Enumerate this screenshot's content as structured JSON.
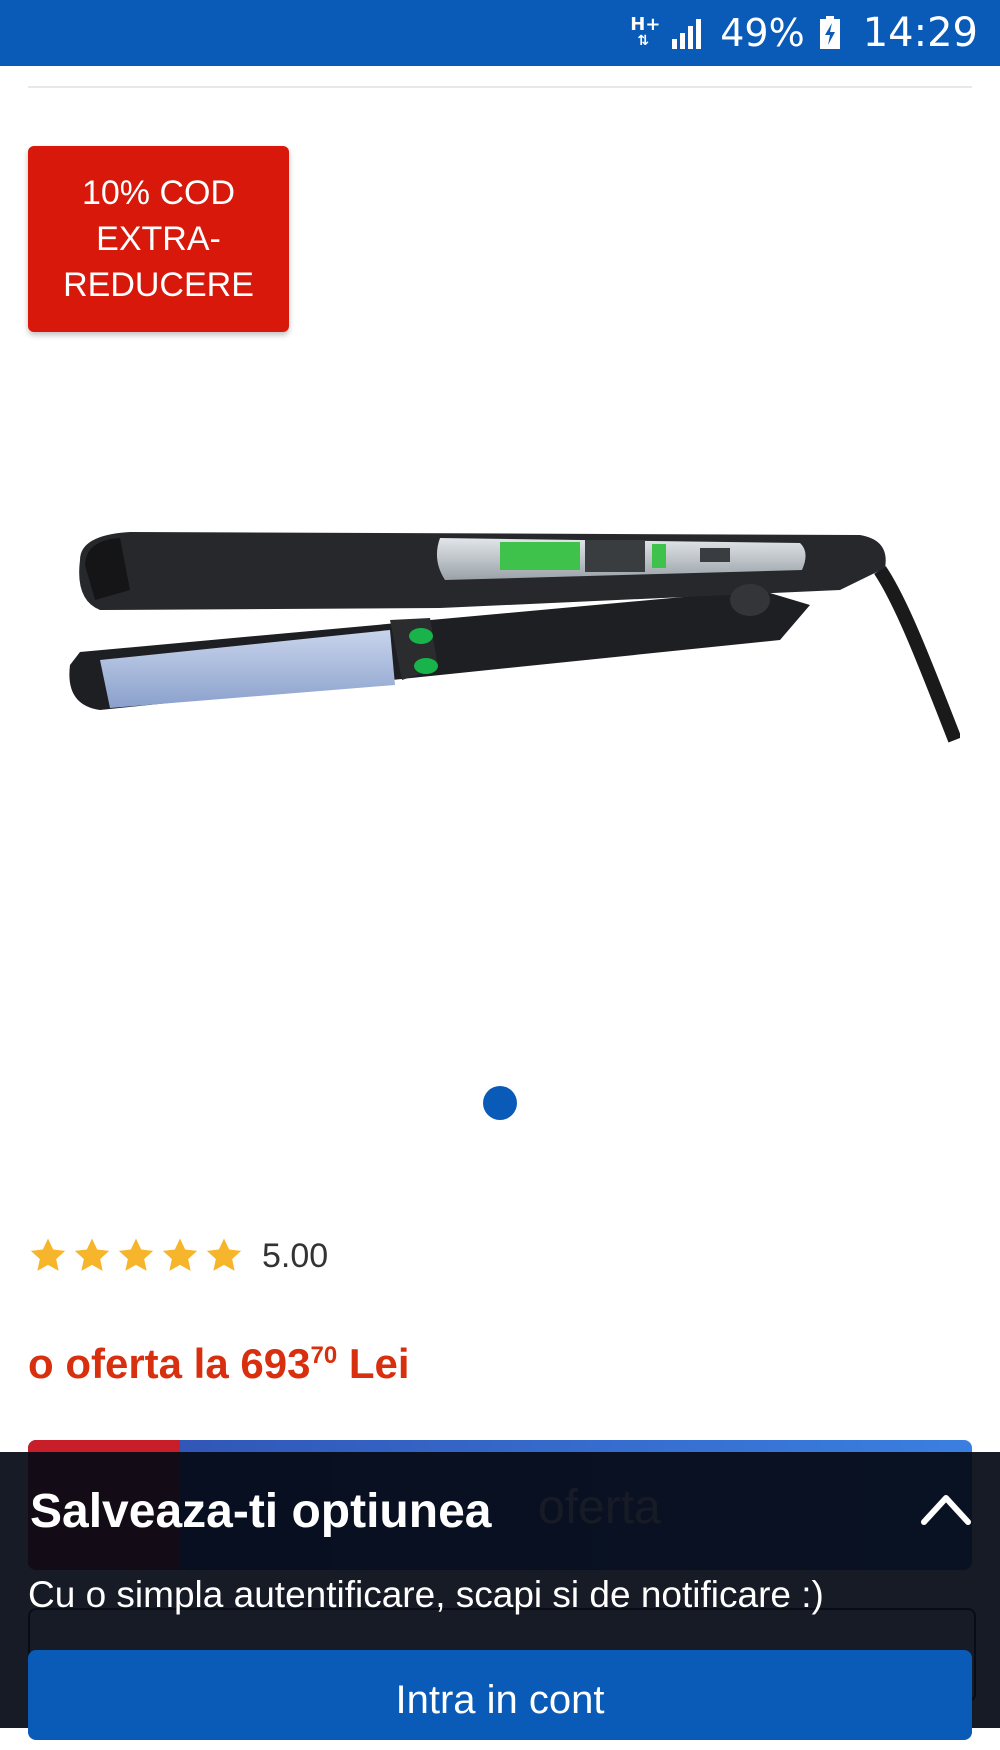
{
  "status_bar": {
    "network": "H+",
    "battery_percent": "49%",
    "time": "14:29",
    "icons": [
      "network-type-icon",
      "signal-icon",
      "battery-charging-icon"
    ]
  },
  "promo_badge": {
    "lines": [
      "10% COD",
      "EXTRA-",
      "REDUCERE"
    ],
    "color": "#d8180a"
  },
  "product": {
    "image": "hair-straightener-product-image",
    "carousel": {
      "current": 1,
      "total": 1
    }
  },
  "rating": {
    "stars": 5,
    "max_stars": 5,
    "score": "5.00",
    "star_color": "#f6b52a"
  },
  "offer": {
    "prefix": "o oferta la ",
    "price_main": "693",
    "price_cents": "70",
    "currency": " Lei",
    "color": "#d8300e"
  },
  "offer_button": {
    "label": "oferta"
  },
  "login_sheet": {
    "title": "Salveaza-ti optiunea",
    "subtitle": "Cu o simpla autentificare, scapi si de notificare :)",
    "button_label": "Intra in cont",
    "collapse_icon": "chevron-up-icon",
    "accent_color": "#0a5ab8"
  }
}
